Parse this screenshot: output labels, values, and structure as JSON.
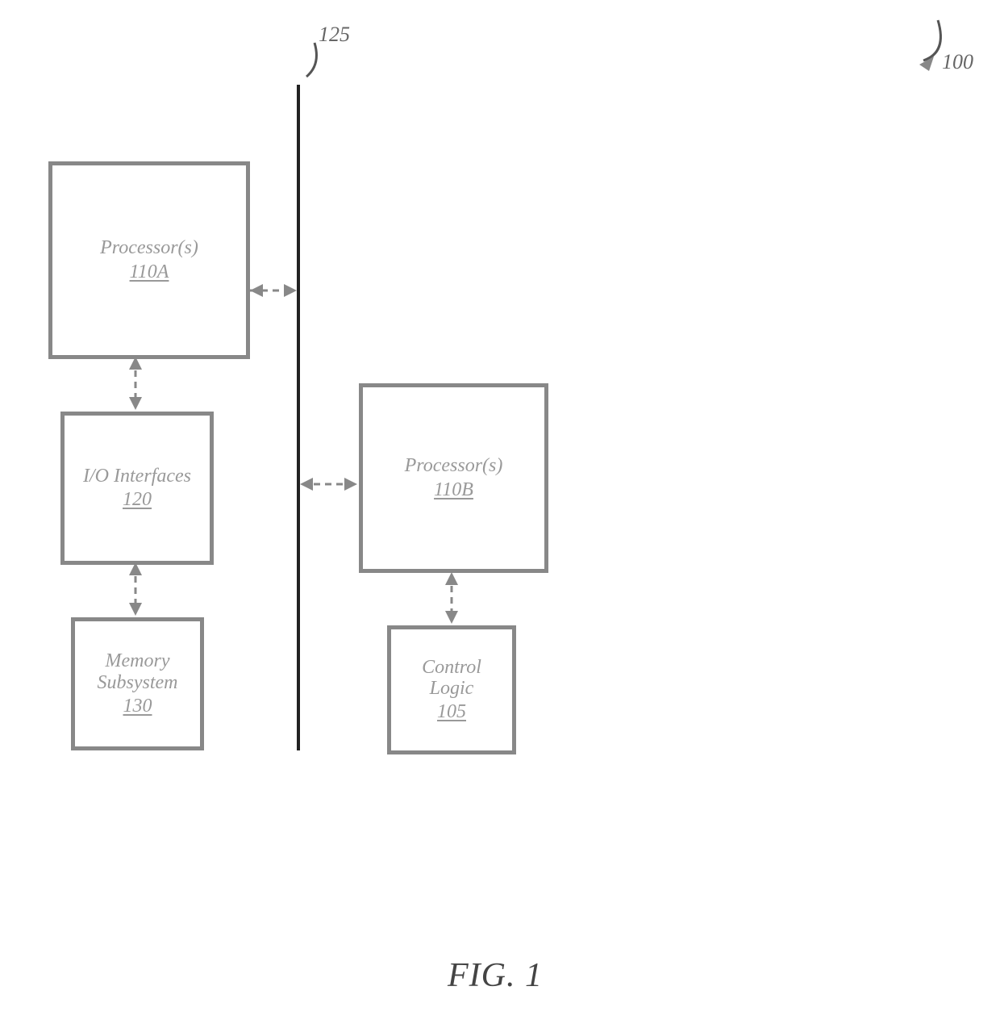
{
  "figure_label": "FIG. 1",
  "system_ref": "100",
  "bus_ref": "125",
  "blocks": {
    "proc_a": {
      "label": "Processor(s)",
      "num": "110A"
    },
    "proc_b": {
      "label": "Processor(s)",
      "num": "110B"
    },
    "io": {
      "label": "I/O Interfaces",
      "num": "120"
    },
    "mem": {
      "label": "Memory Subsystem",
      "num": "130"
    },
    "ctrl": {
      "label": "Control Logic",
      "num": "105"
    }
  }
}
